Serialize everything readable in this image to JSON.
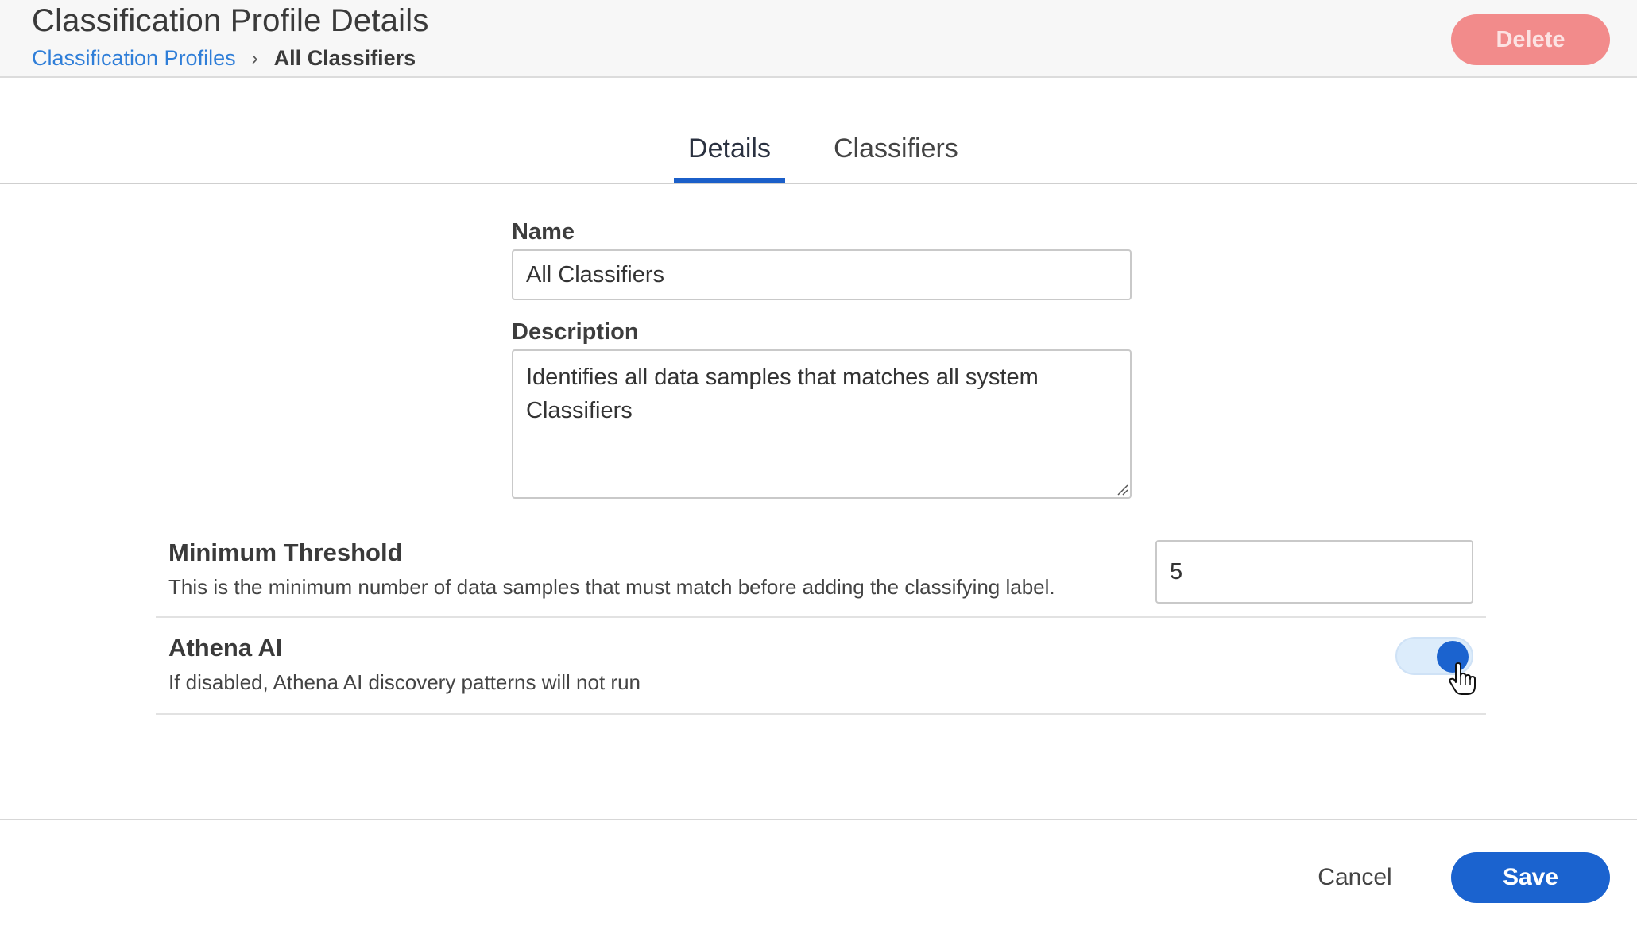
{
  "header": {
    "title": "Classification Profile Details",
    "breadcrumb": {
      "parent": "Classification Profiles",
      "separator": "›",
      "current": "All Classifiers"
    },
    "delete_label": "Delete"
  },
  "tabs": [
    {
      "label": "Details",
      "active": true
    },
    {
      "label": "Classifiers",
      "active": false
    }
  ],
  "form": {
    "name_label": "Name",
    "name_value": "All Classifiers",
    "description_label": "Description",
    "description_value": "Identifies all data samples that matches all system Classifiers"
  },
  "settings": {
    "threshold": {
      "title": "Minimum Threshold",
      "description": "This is the minimum number of data samples that must match before adding the classifying label.",
      "value": "5"
    },
    "athena": {
      "title": "Athena AI",
      "description": "If disabled, Athena AI discovery patterns will not run",
      "enabled": true
    }
  },
  "footer": {
    "cancel_label": "Cancel",
    "save_label": "Save"
  },
  "colors": {
    "primary": "#1b63cf",
    "danger_disabled": "#f28b8b",
    "link": "#2f7ed8"
  },
  "icons": {
    "breadcrumb_separator": "chevron-right-icon",
    "cursor": "hand-pointer-icon",
    "textarea_grip": "resize-grip-icon"
  }
}
